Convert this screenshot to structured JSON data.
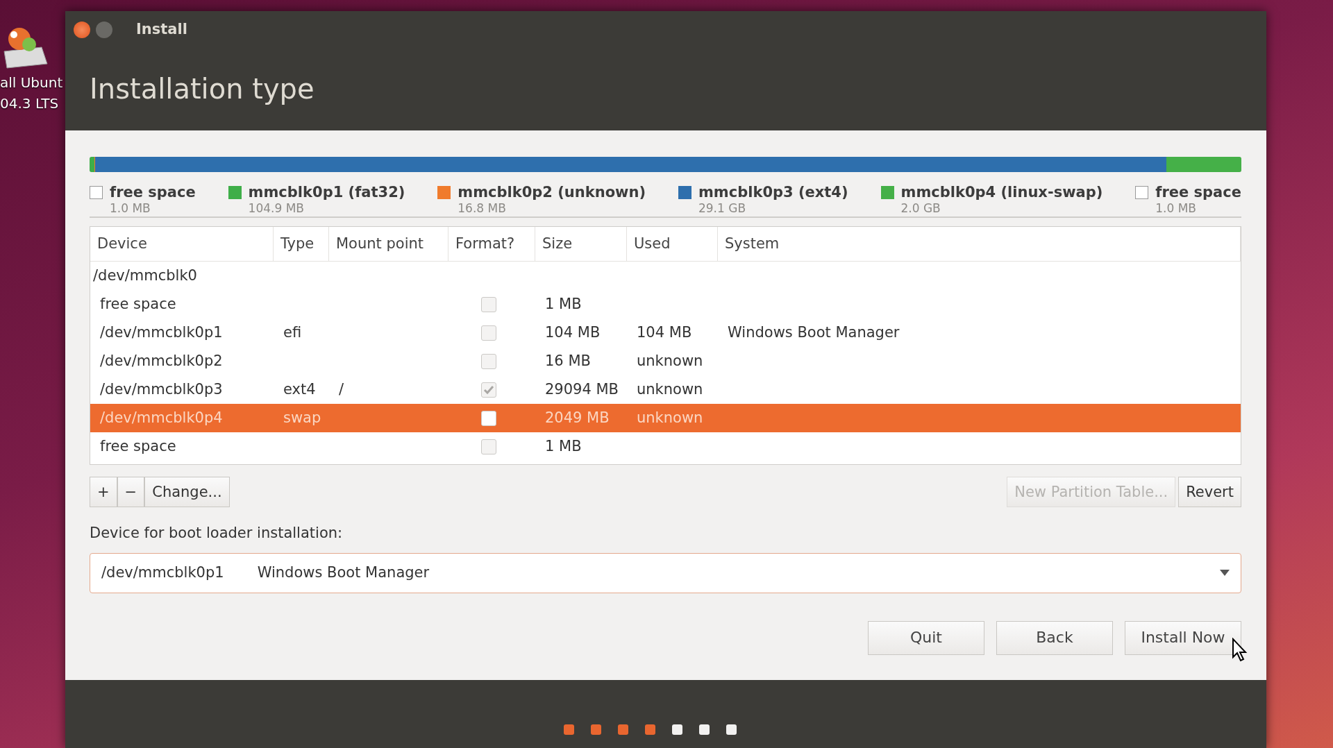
{
  "desktop": {
    "icon_label": [
      "all Ubunt",
      "04.3 LTS"
    ]
  },
  "window": {
    "title": "Install",
    "heading": "Installation type"
  },
  "partition_legend": [
    {
      "kind": "free",
      "name": "free space",
      "size": "1.0 MB"
    },
    {
      "kind": "partition",
      "name": "mmcblk0p1 (fat32)",
      "size": "104.9 MB",
      "color": "#3fae49"
    },
    {
      "kind": "partition",
      "name": "mmcblk0p2 (unknown)",
      "size": "16.8 MB",
      "color": "#f07b2c"
    },
    {
      "kind": "partition",
      "name": "mmcblk0p3 (ext4)",
      "size": "29.1 GB",
      "color": "#2e6fad"
    },
    {
      "kind": "partition",
      "name": "mmcblk0p4 (linux-swap)",
      "size": "2.0 GB",
      "color": "#45b048"
    },
    {
      "kind": "free",
      "name": "free space",
      "size": "1.0 MB"
    }
  ],
  "table": {
    "columns": [
      "Device",
      "Type",
      "Mount point",
      "Format?",
      "Size",
      "Used",
      "System"
    ],
    "disks": [
      {
        "device": "/dev/mmcblk0",
        "children": [
          {
            "device": "free space",
            "format": false,
            "size": "1 MB",
            "selected": false
          },
          {
            "device": "/dev/mmcblk0p1",
            "type": "efi",
            "format": false,
            "size": "104 MB",
            "used": "104 MB",
            "system": "Windows Boot Manager",
            "selected": false
          },
          {
            "device": "/dev/mmcblk0p2",
            "format": false,
            "size": "16 MB",
            "used": "unknown",
            "selected": false
          },
          {
            "device": "/dev/mmcblk0p3",
            "type": "ext4",
            "mount": "/",
            "format": true,
            "size": "29094 MB",
            "used": "unknown",
            "selected": false
          },
          {
            "device": "/dev/mmcblk0p4",
            "type": "swap",
            "format": false,
            "size": "2049 MB",
            "used": "unknown",
            "selected": true
          },
          {
            "device": "free space",
            "format": false,
            "size": "1 MB",
            "selected": false
          }
        ]
      }
    ]
  },
  "toolbar": {
    "left": [
      {
        "label": "+",
        "disabled": false
      },
      {
        "label": "−",
        "disabled": false
      },
      {
        "label": "Change...",
        "disabled": false
      }
    ],
    "right": [
      {
        "label": "New Partition Table...",
        "disabled": true
      },
      {
        "label": "Revert",
        "disabled": false
      }
    ]
  },
  "boot_loader": {
    "label": "Device for boot loader installation:",
    "device": "/dev/mmcblk0p1",
    "name": "Windows Boot Manager"
  },
  "buttons": [
    {
      "label": "Quit"
    },
    {
      "label": "Back"
    },
    {
      "label": "Install Now"
    }
  ],
  "steps": [
    {
      "done": true
    },
    {
      "done": true
    },
    {
      "done": true
    },
    {
      "done": true
    },
    {
      "done": false
    },
    {
      "done": false
    },
    {
      "done": false
    }
  ]
}
